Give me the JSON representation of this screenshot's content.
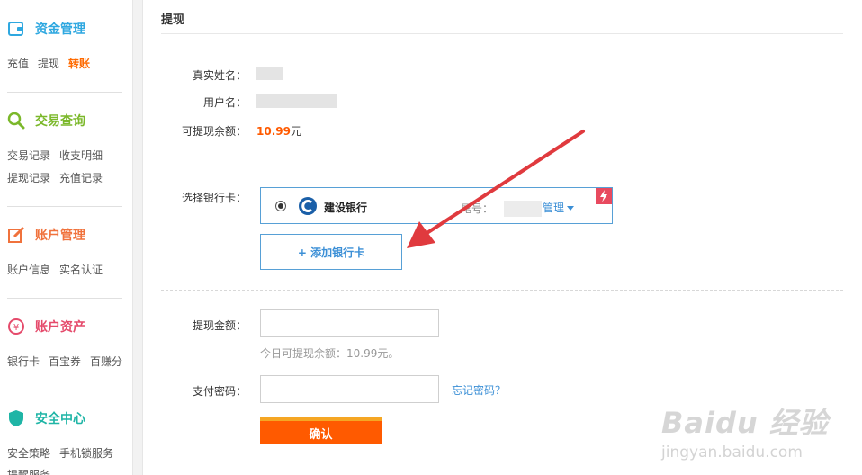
{
  "sidebar": {
    "sections": [
      {
        "title": "资金管理",
        "icon": "wallet-icon",
        "color": "#2fa8e0",
        "links": [
          "充值",
          "提现",
          "转账"
        ]
      },
      {
        "title": "交易查询",
        "icon": "search-icon",
        "color": "#7bb82a",
        "links": [
          "交易记录",
          "收支明细",
          "提现记录",
          "充值记录"
        ]
      },
      {
        "title": "账户管理",
        "icon": "edit-icon",
        "color": "#f0723c",
        "links": [
          "账户信息",
          "实名认证"
        ]
      },
      {
        "title": "账户资产",
        "icon": "yen-icon",
        "color": "#e54a6b",
        "links": [
          "银行卡",
          "百宝券",
          "百赚分"
        ]
      },
      {
        "title": "安全中心",
        "icon": "shield-icon",
        "color": "#1fb5a6",
        "links": [
          "安全策略",
          "手机锁服务",
          "提醒服务"
        ]
      }
    ],
    "active_link": "转账"
  },
  "main": {
    "title": "提现",
    "real_name_label": "真实姓名：",
    "username_label": "用户名：",
    "balance_label": "可提现余额：",
    "balance_value": "10.99",
    "balance_unit": "元",
    "select_card_label": "选择银行卡：",
    "card": {
      "bank_name": "建设银行",
      "tail_label": "尾号：",
      "manage_label": "管理",
      "logo": "ccb-logo-icon"
    },
    "add_card_label": "+ 添加银行卡",
    "amount_label": "提现金额：",
    "amount_hint": "今日可提现余额：10.99元。",
    "password_label": "支付密码：",
    "forgot_password": "忘记密码？",
    "confirm_label": "确认"
  },
  "watermark": {
    "main": "Baidu 经验",
    "sub": "jingyan.baidu.com"
  },
  "colors": {
    "accent_blue": "#3b8fd6",
    "accent_orange": "#ff5a00",
    "arrow_red": "#e03a3e"
  }
}
